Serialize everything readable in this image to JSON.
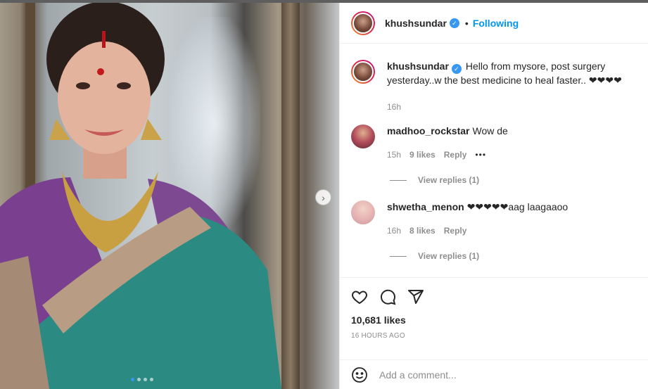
{
  "header": {
    "username": "khushsundar",
    "verified_icon": "verified-badge-icon",
    "separator": "•",
    "follow_label": "Following"
  },
  "media": {
    "next_icon": "chevron-right-icon",
    "next_glyph": "›",
    "dots_total": 4,
    "dots_active": 1
  },
  "caption": {
    "username": "khushsundar",
    "text": "Hello from mysore, post surgery yesterday..w the best medicine to heal faster.. ❤❤❤❤",
    "time": "16h"
  },
  "comments": [
    {
      "username": "madhoo_rockstar",
      "text": "Wow de",
      "time": "15h",
      "likes": "9 likes",
      "reply_label": "Reply",
      "more": "•••",
      "view_replies": "View replies (1)"
    },
    {
      "username": "shwetha_menon",
      "text": "❤❤❤❤❤aag laagaaoo",
      "time": "16h",
      "likes": "8 likes",
      "reply_label": "Reply",
      "view_replies": "View replies (1)"
    }
  ],
  "actions": {
    "icons": [
      "heart-icon",
      "comment-icon",
      "share-icon"
    ],
    "likes": "10,681 likes",
    "posted": "16 HOURS AGO"
  },
  "add_comment": {
    "emoji_icon": "emoji-icon",
    "placeholder": "Add a comment..."
  },
  "colors": {
    "accent": "#0095f6",
    "verified": "#3897f0",
    "muted": "#8e8e8e",
    "text": "#262626"
  }
}
